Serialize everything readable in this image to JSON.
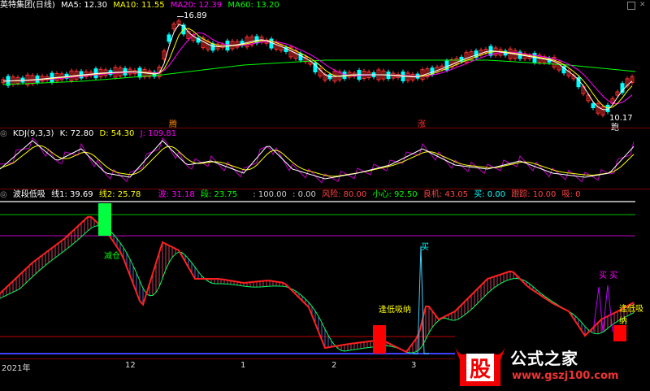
{
  "main": {
    "title": "英特集团(日线)",
    "ma5": "MA5: 12.30",
    "ma10": "MA10: 11.55",
    "ma20": "MA20: 12.39",
    "ma60": "MA60: 13.20",
    "high_label": "16.89",
    "low_label": "10.17",
    "marker_1": "腾",
    "marker_2": "涨",
    "marker_3": "跑"
  },
  "kdj": {
    "title": "KDJ(9,3,3)",
    "k": "K: 72.80",
    "d": "D: 54.30",
    "j": "J: 109.81"
  },
  "wave": {
    "title": "波段低吸",
    "line1": "线1: 39.69",
    "line2": "线2: 25.78",
    "bo": "波: 31.18",
    "duan": "段: 23.75",
    "v100": ": 100.00",
    "v0": ": 0.00",
    "risk": "风险: 80.00",
    "careful": "小心: 92.50",
    "chance": "良机: 43.05",
    "buy": "买: 0.00",
    "track": "跟踪: 10.00",
    "hold": "吸: 0"
  },
  "annotations": {
    "sell": "减仓",
    "buy1": "买",
    "buy2": "买 买",
    "low1": "逢低吸纳",
    "low2": "逢低吸纳"
  },
  "xaxis": {
    "t1": "2021年",
    "t2": "12",
    "t3": "1",
    "t4": "2",
    "t5": "3"
  },
  "watermark": {
    "logo": "股",
    "name": "公式之家",
    "url": "www.gszj100.com"
  },
  "colors": {
    "up": "#ff3030",
    "down": "#00ffff",
    "ma5": "#ffffff",
    "ma10": "#ffff00",
    "ma20": "#ff00ff",
    "ma60": "#00ff00"
  }
}
